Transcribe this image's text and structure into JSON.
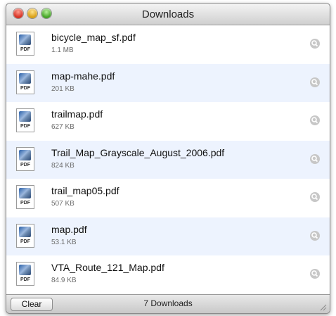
{
  "window": {
    "title": "Downloads"
  },
  "downloads": [
    {
      "name": "bicycle_map_sf.pdf",
      "size": "1.1 MB",
      "type": "PDF"
    },
    {
      "name": "map-mahe.pdf",
      "size": "201 KB",
      "type": "PDF"
    },
    {
      "name": "trailmap.pdf",
      "size": "627 KB",
      "type": "PDF"
    },
    {
      "name": "Trail_Map_Grayscale_August_2006.pdf",
      "size": "824 KB",
      "type": "PDF"
    },
    {
      "name": "trail_map05.pdf",
      "size": "507 KB",
      "type": "PDF"
    },
    {
      "name": "map.pdf",
      "size": "53.1 KB",
      "type": "PDF"
    },
    {
      "name": "VTA_Route_121_Map.pdf",
      "size": "84.9 KB",
      "type": "PDF"
    }
  ],
  "footer": {
    "clear_label": "Clear",
    "count_label": "7 Downloads"
  },
  "colors": {
    "alt_row": "#edf3fe",
    "reveal_icon": "#c7c7c7"
  }
}
